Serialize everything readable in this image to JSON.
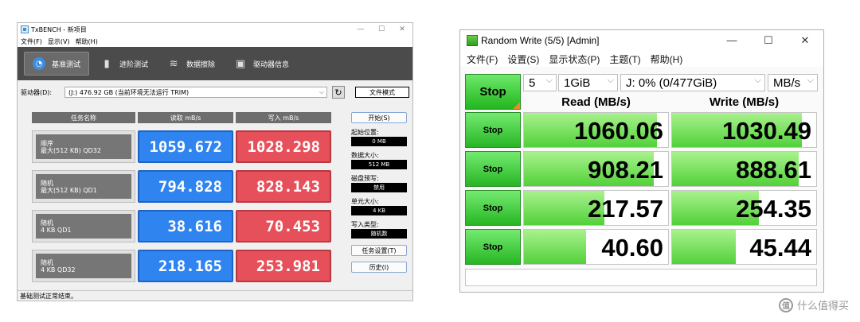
{
  "txbench": {
    "title": "TxBENCH - 新项目",
    "window_controls": [
      "—",
      "☐",
      "✕"
    ],
    "menu": [
      "文件(F)",
      "显示(V)",
      "帮助(H)"
    ],
    "tabs": [
      {
        "label": "基准测试",
        "icon": "timer-icon"
      },
      {
        "label": "进阶测试",
        "icon": "bar-chart-icon"
      },
      {
        "label": "数据擦除",
        "icon": "eraser-icon"
      },
      {
        "label": "驱动器信息",
        "icon": "drive-info-icon"
      }
    ],
    "drive_label": "驱动器(D):",
    "drive_value": "(J:)  476.92 GB (当前环境无法运行 TRIM)",
    "mode_button": "文件模式",
    "headers": {
      "name": "任务名称",
      "read": "读取 mB/s",
      "write": "写入 mB/s"
    },
    "rows": [
      {
        "line1": "顺序",
        "line2": "最大(512 KB) QD32",
        "read": "1059.672",
        "write": "1028.298"
      },
      {
        "line1": "随机",
        "line2": "最大(512 KB) QD1",
        "read": "794.828",
        "write": "828.143"
      },
      {
        "line1": "随机",
        "line2": "4 KB QD1",
        "read": "38.616",
        "write": "70.453"
      },
      {
        "line1": "随机",
        "line2": "4 KB QD32",
        "read": "218.165",
        "write": "253.981"
      }
    ],
    "start_button": "开始(S)",
    "start_pos_label": "起始位置:",
    "start_pos_value": "0 MB",
    "data_size_label": "数据大小:",
    "data_size_value": "512 MB",
    "prefetch_label": "磁盘预写:",
    "prefetch_value": "禁用",
    "unit_size_label": "单元大小:",
    "unit_size_value": "4 KB",
    "write_type_label": "写入类型:",
    "write_type_value": "随机数",
    "task_settings_button": "任务设置(T)",
    "history_button": "历史(I)",
    "status": "基础测试正常结束。"
  },
  "cdm": {
    "title": "Random Write (5/5) [Admin]",
    "window_controls": [
      "—",
      "☐",
      "✕"
    ],
    "menu": [
      "文件(F)",
      "设置(S)",
      "显示状态(P)",
      "主题(T)",
      "帮助(H)"
    ],
    "main_button": "Stop",
    "count": "5",
    "size": "1GiB",
    "drive": "J: 0% (0/477GiB)",
    "unit": "MB/s",
    "read_header": "Read (MB/s)",
    "write_header": "Write (MB/s)",
    "rows": [
      {
        "button": "Stop",
        "read": "1060.06",
        "write": "1030.49",
        "read_level": 0.92,
        "write_level": 0.9
      },
      {
        "button": "Stop",
        "read": "908.21",
        "write": "888.61",
        "read_level": 0.9,
        "write_level": 0.88
      },
      {
        "button": "Stop",
        "read": "217.57",
        "write": "254.35",
        "read_level": 0.56,
        "write_level": 0.6
      },
      {
        "button": "Stop",
        "read": "40.60",
        "write": "45.44",
        "read_level": 0.43,
        "write_level": 0.44
      }
    ]
  },
  "watermark": {
    "text": "什么值得买",
    "icon": "zhi-logo-icon"
  }
}
